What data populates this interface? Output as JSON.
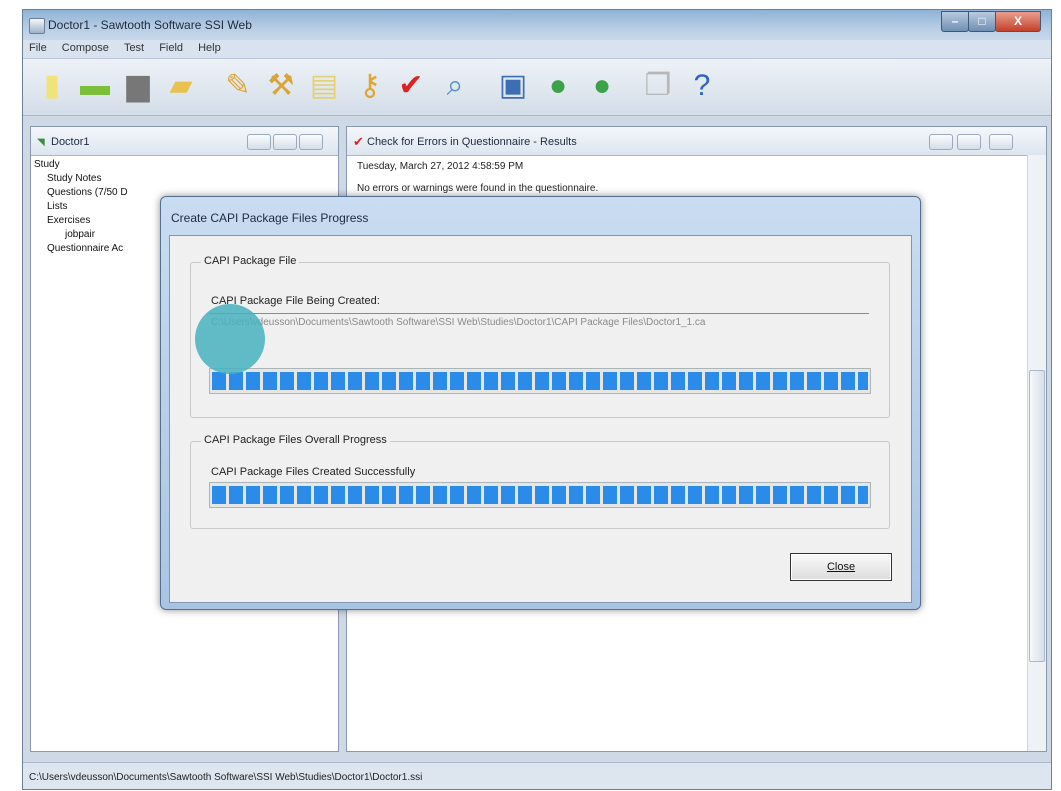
{
  "window": {
    "title": "Doctor1 - Sawtooth Software SSI Web",
    "min": "–",
    "max": "□",
    "close": "X"
  },
  "menu": [
    "File",
    "Compose",
    "Test",
    "Field",
    "Help"
  ],
  "toolbar": {
    "icons": [
      "new-file-icon",
      "open-folder-icon",
      "print-icon",
      "folder-icon",
      "pencil-icon",
      "wrench-icon",
      "notepad-icon",
      "key-icon",
      "checkmark-icon",
      "magnifier-icon",
      "monitor-icon",
      "globe-icon",
      "globe-arrow-icon",
      "copy-icon",
      "help-icon"
    ]
  },
  "left_panel": {
    "title": "Doctor1",
    "tree": [
      "Study",
      "Study Notes",
      "Questions (7/50 D",
      "Lists",
      "Exercises",
      "jobpair",
      "Questionnaire Ac"
    ]
  },
  "right_panel": {
    "title": "Check for Errors in Questionnaire - Results",
    "date": "Tuesday, March 27, 2012  4:58:59 PM",
    "message": "No errors or warnings were found in the questionnaire."
  },
  "dialog": {
    "title": "Create CAPI Package Files Progress",
    "group1": {
      "label": "CAPI Package File",
      "field_label": "CAPI Package File Being Created:",
      "path": "C:\\Users\\vdeusson\\Documents\\Sawtooth Software\\SSI Web\\Studies\\Doctor1\\CAPI Package Files\\Doctor1_1.ca",
      "progress": 1.0
    },
    "group2": {
      "label": "CAPI Package Files Overall Progress",
      "status": "CAPI Package Files Created Successfully",
      "progress": 1.0
    },
    "close_button": "Close"
  },
  "statusbar": {
    "text": "C:\\Users\\vdeusson\\Documents\\Sawtooth Software\\SSI Web\\Studies\\Doctor1\\Doctor1.ssi"
  }
}
